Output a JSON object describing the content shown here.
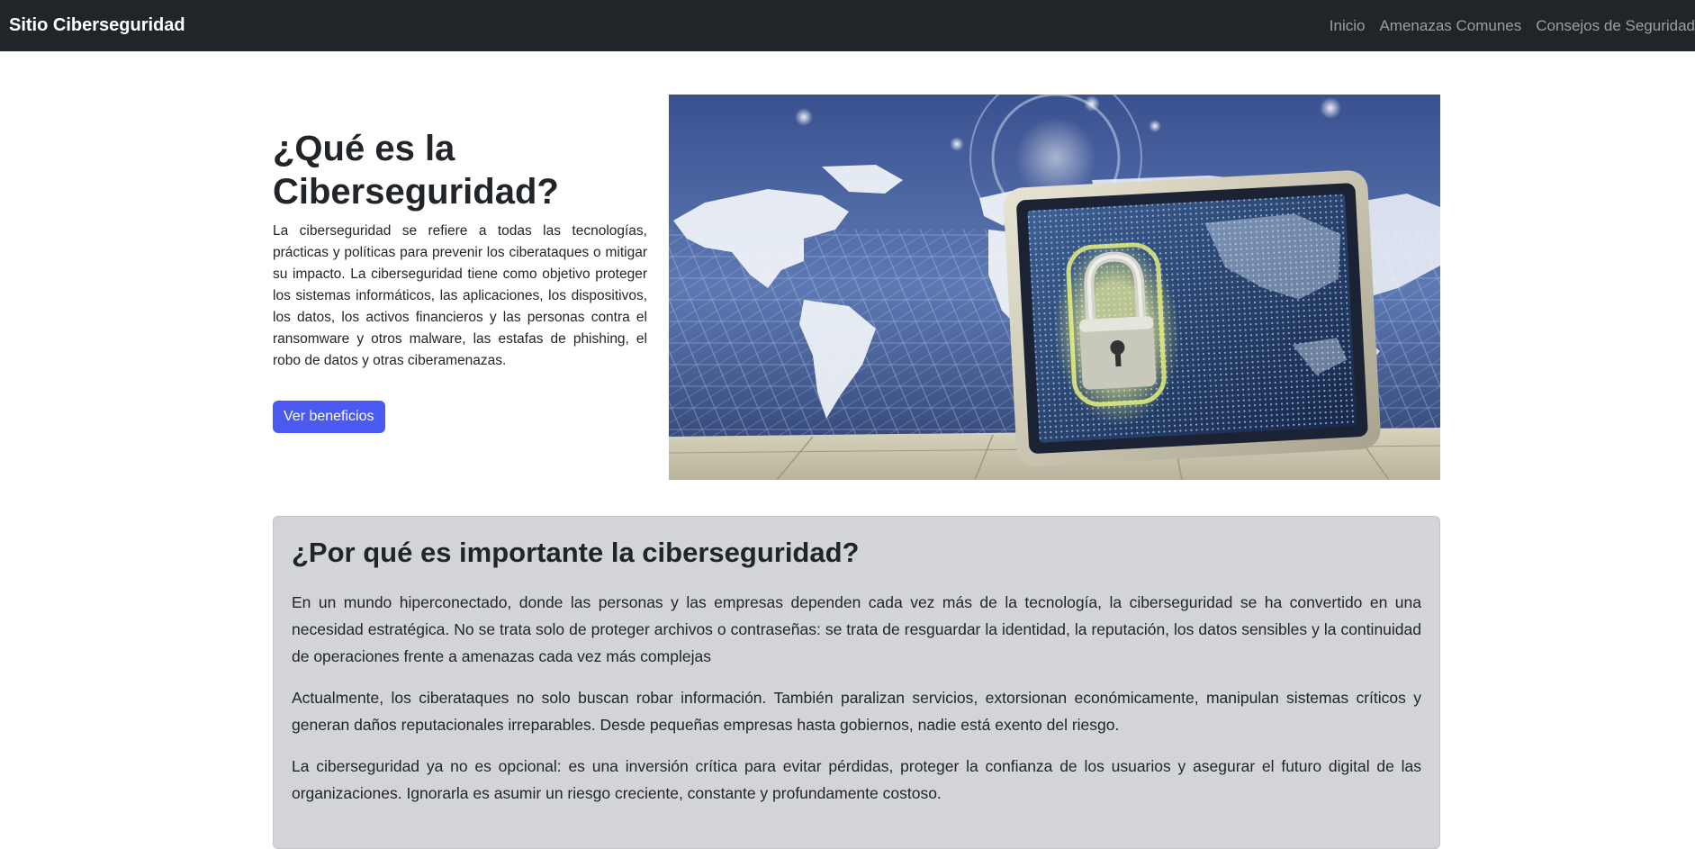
{
  "navbar": {
    "brand": "Sitio Ciberseguridad",
    "links": [
      "Inicio",
      "Amenazas Comunes",
      "Consejos de Seguridad"
    ]
  },
  "hero": {
    "title": "¿Qué es la Ciberseguridad?",
    "paragraph": "La ciberseguridad se refiere a todas las tecnologías, prácticas y políticas para prevenir los ciberataques o mitigar su impacto. La ciberseguridad tiene como objetivo proteger los sistemas informáticos, las aplicaciones, los dispositivos, los datos, los activos financieros y las personas contra el ransomware y otros malware, las estafas de phishing, el robo de datos y otras ciberamenazas.",
    "button_label": "Ver beneficios",
    "image_icon": "tablet-padlock-world-map-illustration"
  },
  "importance": {
    "title": "¿Por qué es importante la ciberseguridad?",
    "paragraphs": [
      "En un mundo hiperconectado, donde las personas y las empresas dependen cada vez más de la tecnología, la ciberseguridad se ha convertido en una necesidad estratégica. No se trata solo de proteger archivos o contraseñas: se trata de resguardar la identidad, la reputación, los datos sensibles y la continuidad de operaciones frente a amenazas cada vez más complejas",
      "Actualmente, los ciberataques no solo buscan robar información. También paralizan servicios, extorsionan económicamente, manipulan sistemas críticos y generan daños reputacionales irreparables. Desde pequeñas empresas hasta gobiernos, nadie está exento del riesgo.",
      "La ciberseguridad ya no es opcional: es una inversión crítica para evitar pérdidas, proteger la confianza de los usuarios y asegurar el futuro digital de las organizaciones. Ignorarla es asumir un riesgo creciente, constante y profundamente costoso."
    ]
  },
  "colors": {
    "navbar_bg": "#212529",
    "button_bg": "#4a5af0",
    "card_bg": "#d3d4d8"
  }
}
